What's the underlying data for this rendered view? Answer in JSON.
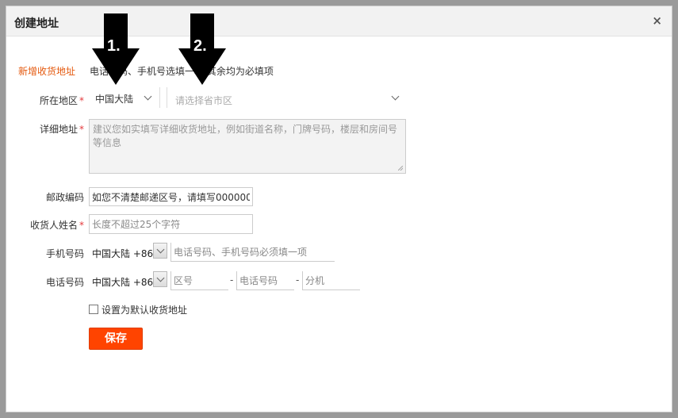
{
  "dialog": {
    "title": "创建地址",
    "close_label": "×"
  },
  "form": {
    "section_title": "新增收货地址",
    "hint": "电话号码、手机号选填一项,其余均为必填项",
    "region": {
      "label": "所在地区",
      "country_value": "中国大陆",
      "area_placeholder": "请选择省市区"
    },
    "detail": {
      "label": "详细地址",
      "placeholder": "建议您如实填写详细收货地址，例如街道名称，门牌号码，楼层和房间号等信息"
    },
    "postcode": {
      "label": "邮政编码",
      "value": "如您不清楚邮递区号，请填写000000"
    },
    "recipient": {
      "label": "收货人姓名",
      "placeholder": "长度不超过25个字符"
    },
    "mobile": {
      "label": "手机号码",
      "country": "中国大陆 +86",
      "placeholder": "电话号码、手机号码必须填一项"
    },
    "phone": {
      "label": "电话号码",
      "country": "中国大陆 +86",
      "area_placeholder": "区号",
      "number_placeholder": "电话号码",
      "ext_placeholder": "分机",
      "separator": "-"
    },
    "default_checkbox_label": "设置为默认收货地址",
    "save_label": "保存"
  },
  "annotations": {
    "arrow1": "1.",
    "arrow2": "2."
  },
  "icons": [
    "close-icon",
    "chevron-down-icon",
    "resize-grip-icon",
    "arrow-down-icon"
  ],
  "colors": {
    "accent": "#e4590e",
    "required": "#e4393c",
    "save_button": "#ff4400"
  }
}
